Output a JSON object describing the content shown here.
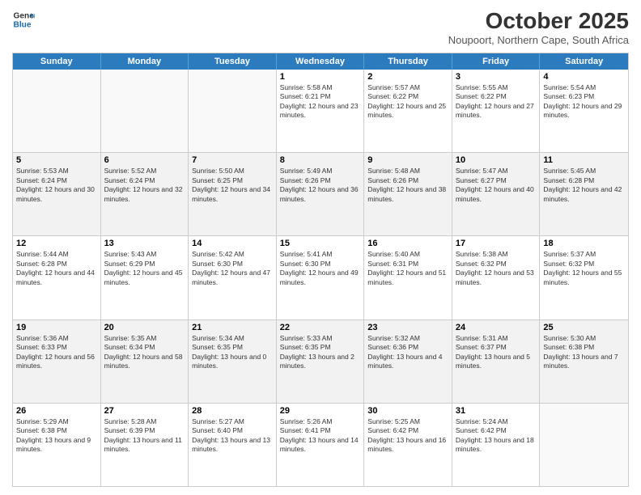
{
  "header": {
    "logo_line1": "General",
    "logo_line2": "Blue",
    "month_title": "October 2025",
    "location": "Noupoort, Northern Cape, South Africa"
  },
  "days_of_week": [
    "Sunday",
    "Monday",
    "Tuesday",
    "Wednesday",
    "Thursday",
    "Friday",
    "Saturday"
  ],
  "weeks": [
    [
      {
        "day": "",
        "sunrise": "",
        "sunset": "",
        "daylight": "",
        "empty": true
      },
      {
        "day": "",
        "sunrise": "",
        "sunset": "",
        "daylight": "",
        "empty": true
      },
      {
        "day": "",
        "sunrise": "",
        "sunset": "",
        "daylight": "",
        "empty": true
      },
      {
        "day": "1",
        "sunrise": "Sunrise: 5:58 AM",
        "sunset": "Sunset: 6:21 PM",
        "daylight": "Daylight: 12 hours and 23 minutes."
      },
      {
        "day": "2",
        "sunrise": "Sunrise: 5:57 AM",
        "sunset": "Sunset: 6:22 PM",
        "daylight": "Daylight: 12 hours and 25 minutes."
      },
      {
        "day": "3",
        "sunrise": "Sunrise: 5:55 AM",
        "sunset": "Sunset: 6:22 PM",
        "daylight": "Daylight: 12 hours and 27 minutes."
      },
      {
        "day": "4",
        "sunrise": "Sunrise: 5:54 AM",
        "sunset": "Sunset: 6:23 PM",
        "daylight": "Daylight: 12 hours and 29 minutes."
      }
    ],
    [
      {
        "day": "5",
        "sunrise": "Sunrise: 5:53 AM",
        "sunset": "Sunset: 6:24 PM",
        "daylight": "Daylight: 12 hours and 30 minutes."
      },
      {
        "day": "6",
        "sunrise": "Sunrise: 5:52 AM",
        "sunset": "Sunset: 6:24 PM",
        "daylight": "Daylight: 12 hours and 32 minutes."
      },
      {
        "day": "7",
        "sunrise": "Sunrise: 5:50 AM",
        "sunset": "Sunset: 6:25 PM",
        "daylight": "Daylight: 12 hours and 34 minutes."
      },
      {
        "day": "8",
        "sunrise": "Sunrise: 5:49 AM",
        "sunset": "Sunset: 6:26 PM",
        "daylight": "Daylight: 12 hours and 36 minutes."
      },
      {
        "day": "9",
        "sunrise": "Sunrise: 5:48 AM",
        "sunset": "Sunset: 6:26 PM",
        "daylight": "Daylight: 12 hours and 38 minutes."
      },
      {
        "day": "10",
        "sunrise": "Sunrise: 5:47 AM",
        "sunset": "Sunset: 6:27 PM",
        "daylight": "Daylight: 12 hours and 40 minutes."
      },
      {
        "day": "11",
        "sunrise": "Sunrise: 5:45 AM",
        "sunset": "Sunset: 6:28 PM",
        "daylight": "Daylight: 12 hours and 42 minutes."
      }
    ],
    [
      {
        "day": "12",
        "sunrise": "Sunrise: 5:44 AM",
        "sunset": "Sunset: 6:28 PM",
        "daylight": "Daylight: 12 hours and 44 minutes."
      },
      {
        "day": "13",
        "sunrise": "Sunrise: 5:43 AM",
        "sunset": "Sunset: 6:29 PM",
        "daylight": "Daylight: 12 hours and 45 minutes."
      },
      {
        "day": "14",
        "sunrise": "Sunrise: 5:42 AM",
        "sunset": "Sunset: 6:30 PM",
        "daylight": "Daylight: 12 hours and 47 minutes."
      },
      {
        "day": "15",
        "sunrise": "Sunrise: 5:41 AM",
        "sunset": "Sunset: 6:30 PM",
        "daylight": "Daylight: 12 hours and 49 minutes."
      },
      {
        "day": "16",
        "sunrise": "Sunrise: 5:40 AM",
        "sunset": "Sunset: 6:31 PM",
        "daylight": "Daylight: 12 hours and 51 minutes."
      },
      {
        "day": "17",
        "sunrise": "Sunrise: 5:38 AM",
        "sunset": "Sunset: 6:32 PM",
        "daylight": "Daylight: 12 hours and 53 minutes."
      },
      {
        "day": "18",
        "sunrise": "Sunrise: 5:37 AM",
        "sunset": "Sunset: 6:32 PM",
        "daylight": "Daylight: 12 hours and 55 minutes."
      }
    ],
    [
      {
        "day": "19",
        "sunrise": "Sunrise: 5:36 AM",
        "sunset": "Sunset: 6:33 PM",
        "daylight": "Daylight: 12 hours and 56 minutes."
      },
      {
        "day": "20",
        "sunrise": "Sunrise: 5:35 AM",
        "sunset": "Sunset: 6:34 PM",
        "daylight": "Daylight: 12 hours and 58 minutes."
      },
      {
        "day": "21",
        "sunrise": "Sunrise: 5:34 AM",
        "sunset": "Sunset: 6:35 PM",
        "daylight": "Daylight: 13 hours and 0 minutes."
      },
      {
        "day": "22",
        "sunrise": "Sunrise: 5:33 AM",
        "sunset": "Sunset: 6:35 PM",
        "daylight": "Daylight: 13 hours and 2 minutes."
      },
      {
        "day": "23",
        "sunrise": "Sunrise: 5:32 AM",
        "sunset": "Sunset: 6:36 PM",
        "daylight": "Daylight: 13 hours and 4 minutes."
      },
      {
        "day": "24",
        "sunrise": "Sunrise: 5:31 AM",
        "sunset": "Sunset: 6:37 PM",
        "daylight": "Daylight: 13 hours and 5 minutes."
      },
      {
        "day": "25",
        "sunrise": "Sunrise: 5:30 AM",
        "sunset": "Sunset: 6:38 PM",
        "daylight": "Daylight: 13 hours and 7 minutes."
      }
    ],
    [
      {
        "day": "26",
        "sunrise": "Sunrise: 5:29 AM",
        "sunset": "Sunset: 6:38 PM",
        "daylight": "Daylight: 13 hours and 9 minutes."
      },
      {
        "day": "27",
        "sunrise": "Sunrise: 5:28 AM",
        "sunset": "Sunset: 6:39 PM",
        "daylight": "Daylight: 13 hours and 11 minutes."
      },
      {
        "day": "28",
        "sunrise": "Sunrise: 5:27 AM",
        "sunset": "Sunset: 6:40 PM",
        "daylight": "Daylight: 13 hours and 13 minutes."
      },
      {
        "day": "29",
        "sunrise": "Sunrise: 5:26 AM",
        "sunset": "Sunset: 6:41 PM",
        "daylight": "Daylight: 13 hours and 14 minutes."
      },
      {
        "day": "30",
        "sunrise": "Sunrise: 5:25 AM",
        "sunset": "Sunset: 6:42 PM",
        "daylight": "Daylight: 13 hours and 16 minutes."
      },
      {
        "day": "31",
        "sunrise": "Sunrise: 5:24 AM",
        "sunset": "Sunset: 6:42 PM",
        "daylight": "Daylight: 13 hours and 18 minutes."
      },
      {
        "day": "",
        "sunrise": "",
        "sunset": "",
        "daylight": "",
        "empty": true
      }
    ]
  ]
}
